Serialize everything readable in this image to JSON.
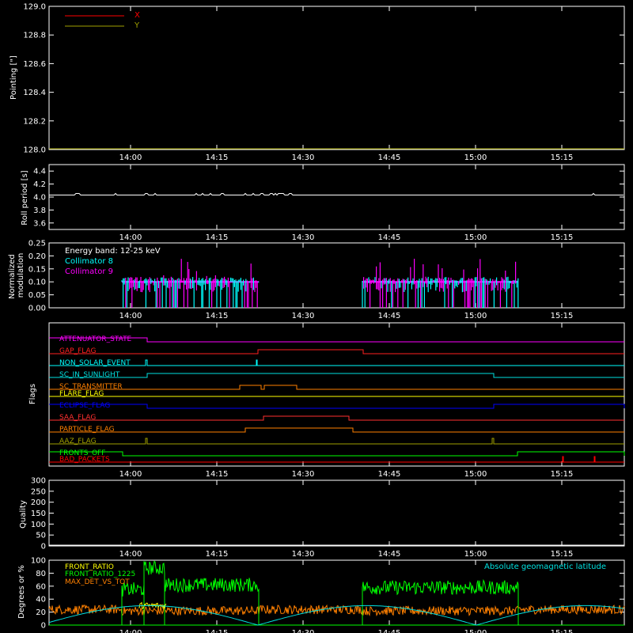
{
  "time_axis": {
    "ticks": [
      "14:00",
      "14:15",
      "14:30",
      "14:45",
      "15:00",
      "15:15"
    ]
  },
  "chart_data": [
    {
      "type": "line",
      "panel": "pointing",
      "ylabel": "Pointing [\"]",
      "ylim": [
        128.0,
        129.0
      ],
      "yticks": [
        "129.0",
        "128.8",
        "128.6",
        "128.4",
        "128.2",
        "128.0"
      ],
      "series": [
        {
          "name": "X",
          "color": "#ff0000",
          "values": []
        },
        {
          "name": "Y",
          "color": "#a0a000",
          "values": []
        }
      ]
    },
    {
      "type": "line",
      "panel": "roll_period",
      "ylabel": "Roll period [s]",
      "ylim": [
        3.5,
        4.5
      ],
      "yticks": [
        "4.4",
        "4.2",
        "4.0",
        "3.8",
        "3.6"
      ],
      "series": [
        {
          "color": "#ffffff",
          "baseline": 4.03
        }
      ]
    },
    {
      "type": "line",
      "panel": "modulation",
      "ylabel": "Normalized modulation",
      "ylim": [
        0.0,
        0.25
      ],
      "yticks": [
        "0.25",
        "0.20",
        "0.15",
        "0.10",
        "0.05",
        "0.00"
      ],
      "annotation": "Energy band: 12-25 keV",
      "series": [
        {
          "name": "Collimator 8",
          "color": "#00ffff"
        },
        {
          "name": "Collimator 9",
          "color": "#ff00ff"
        }
      ]
    },
    {
      "type": "table",
      "panel": "flags",
      "ylabel": "Flags",
      "flags": [
        {
          "name": "ATTENUATOR_STATE",
          "color": "#ff00ff"
        },
        {
          "name": "GAP_FLAG",
          "color": "#ff2020"
        },
        {
          "name": "NON_SOLAR_EVENT",
          "color": "#00ffff"
        },
        {
          "name": "SC_IN_SUNLIGHT",
          "color": "#00e0e0"
        },
        {
          "name": "SC_TRANSMITTER",
          "color": "#ff8000"
        },
        {
          "name": "FLARE_FLAG",
          "color": "#ffff00"
        },
        {
          "name": "ECLIPSE_FLAG",
          "color": "#0000ff"
        },
        {
          "name": "SAA_FLAG",
          "color": "#ff3030"
        },
        {
          "name": "PARTICLE_FLAG",
          "color": "#ff8000"
        },
        {
          "name": "AAZ_FLAG",
          "color": "#a0a000"
        },
        {
          "name": "FRONTS_OFF",
          "color": "#00ff00"
        },
        {
          "name": "BAD_PACKETS",
          "color": "#ff0000"
        }
      ]
    },
    {
      "type": "line",
      "panel": "quality",
      "ylabel": "Quality",
      "ylim": [
        0,
        300
      ],
      "yticks": [
        "300",
        "250",
        "200",
        "150",
        "100",
        "50",
        "0"
      ],
      "series": [
        {
          "color": "#ffffff",
          "value": 0
        }
      ]
    },
    {
      "type": "line",
      "panel": "ratios",
      "ylabel": "Degrees or %",
      "ylim": [
        0,
        100
      ],
      "yticks": [
        "100",
        "80",
        "60",
        "40",
        "20",
        "0"
      ],
      "annotation": "Absolute geomagnetic latitude",
      "series": [
        {
          "name": "FRONT_RATIO",
          "color": "#ffff00"
        },
        {
          "name": "FRONT_RATIO_1225",
          "color": "#00ff00"
        },
        {
          "name": "MAX_DET_VS_TOT",
          "color": "#ff8000"
        },
        {
          "name": "Absolute geomagnetic latitude",
          "color": "#00e0e0"
        }
      ]
    }
  ]
}
